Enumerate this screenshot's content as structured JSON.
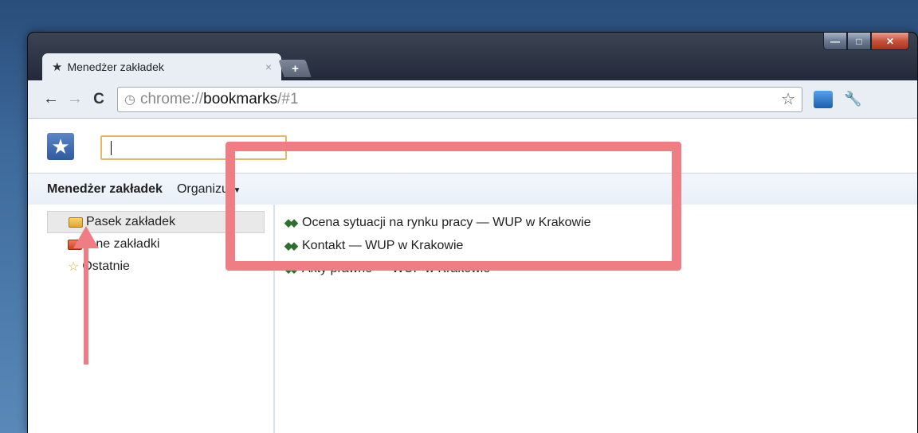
{
  "window": {
    "minimize": "—",
    "maximize": "□",
    "close": "✕"
  },
  "tab": {
    "title": "Menedżer zakładek",
    "close": "×",
    "new_tab": "+"
  },
  "toolbar": {
    "back": "←",
    "forward": "→",
    "reload": "C",
    "url_scheme": "chrome://",
    "url_host": "bookmarks",
    "url_path": "/#1",
    "bookmark_star": "☆",
    "wrench": "🔧"
  },
  "search": {
    "value": "",
    "placeholder": ""
  },
  "header": {
    "title": "Menedżer zakładek",
    "organize": "Organizuj"
  },
  "tree": {
    "items": [
      {
        "label": "Pasek zakładek"
      },
      {
        "label": "Inne zakładki"
      },
      {
        "label": "Ostatnie"
      }
    ]
  },
  "bookmarks": {
    "items": [
      {
        "label": "Ocena sytuacji na rynku pracy — WUP w Krakowie"
      },
      {
        "label": "Kontakt — WUP w Krakowie"
      },
      {
        "label": "Akty prawne — WUP w Krakowie"
      }
    ]
  },
  "colors": {
    "highlight": "#ef7d83",
    "accent": "#2f5b9f"
  }
}
